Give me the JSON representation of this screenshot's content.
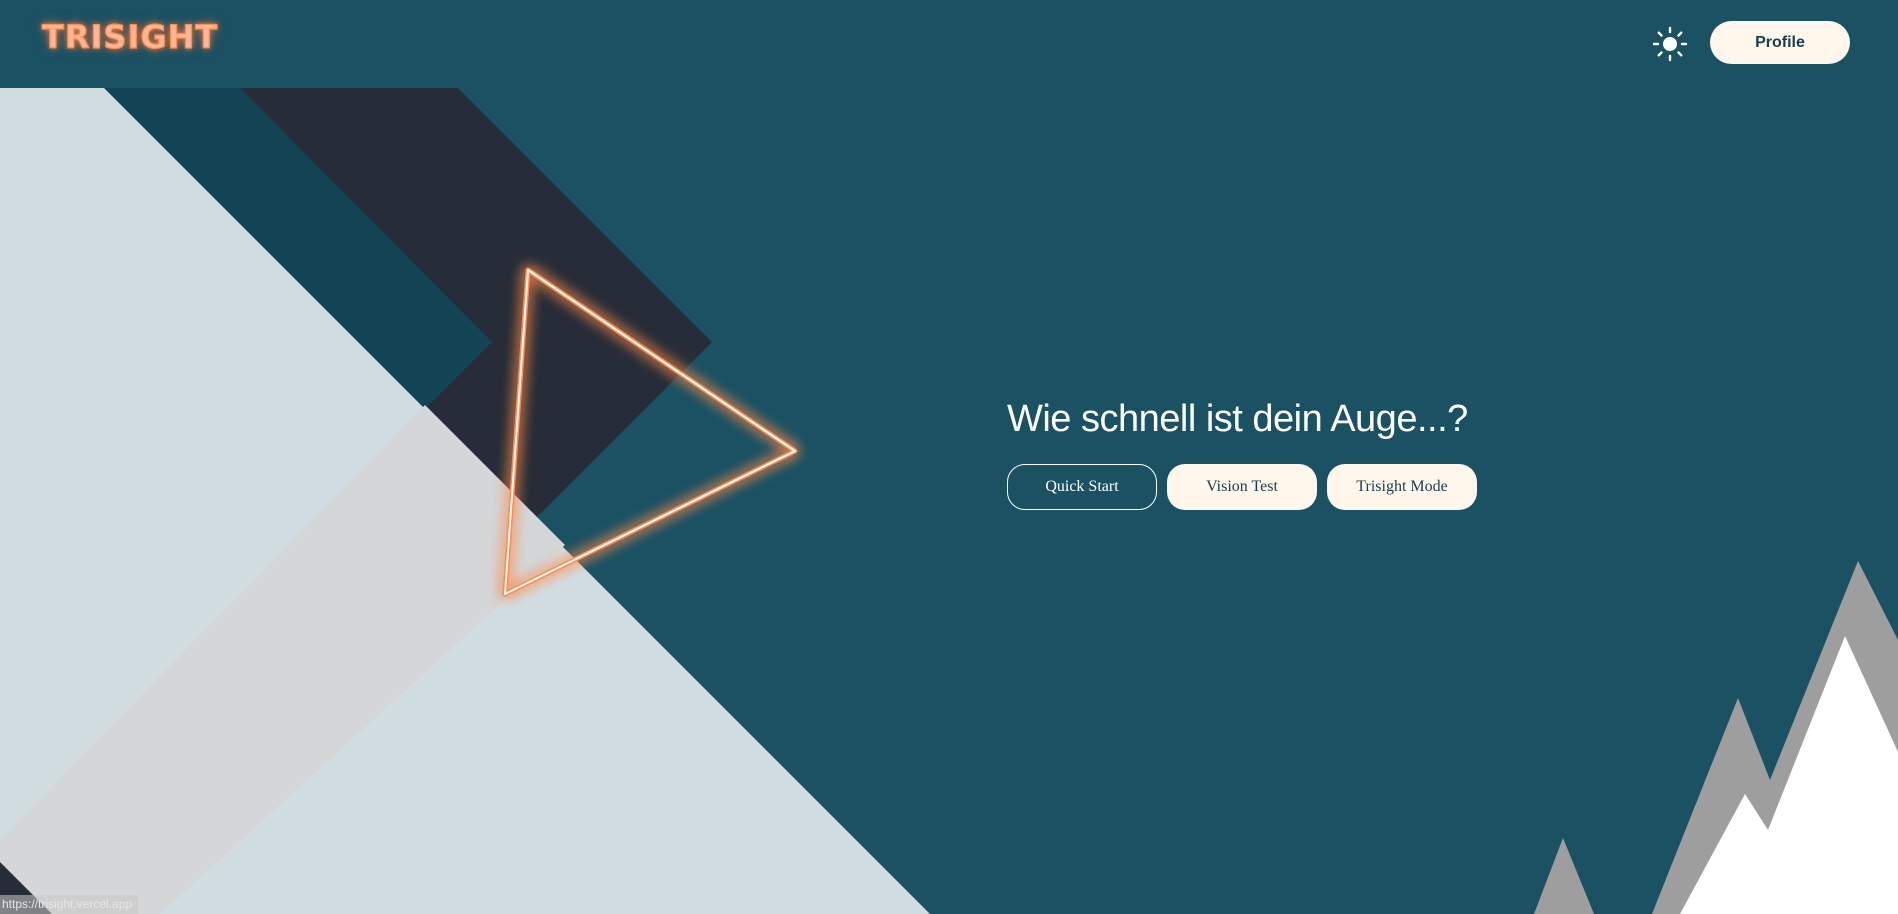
{
  "header": {
    "logo_text": "TRISIGHT",
    "theme_toggle_icon": "sun-icon",
    "profile_label": "Profile"
  },
  "hero": {
    "title": "Wie schnell ist dein Auge...?",
    "buttons": [
      {
        "label": "Quick Start",
        "style": "outline"
      },
      {
        "label": "Vision Test",
        "style": "filled"
      },
      {
        "label": "Trisight Mode",
        "style": "filled"
      }
    ]
  },
  "status_bar": {
    "url": "https://trisight.vercel.app"
  },
  "colors": {
    "background": "#1a5163",
    "dark_band": "#262d38",
    "teal_band": "#124455",
    "light_shape": "#d2dde2",
    "gray_band": "#d4d6d8",
    "accent_glow": "#ff8a4c",
    "button_fill": "#fff7ec",
    "mountain_gray": "#9e9e9e",
    "mountain_white": "#ffffff"
  }
}
